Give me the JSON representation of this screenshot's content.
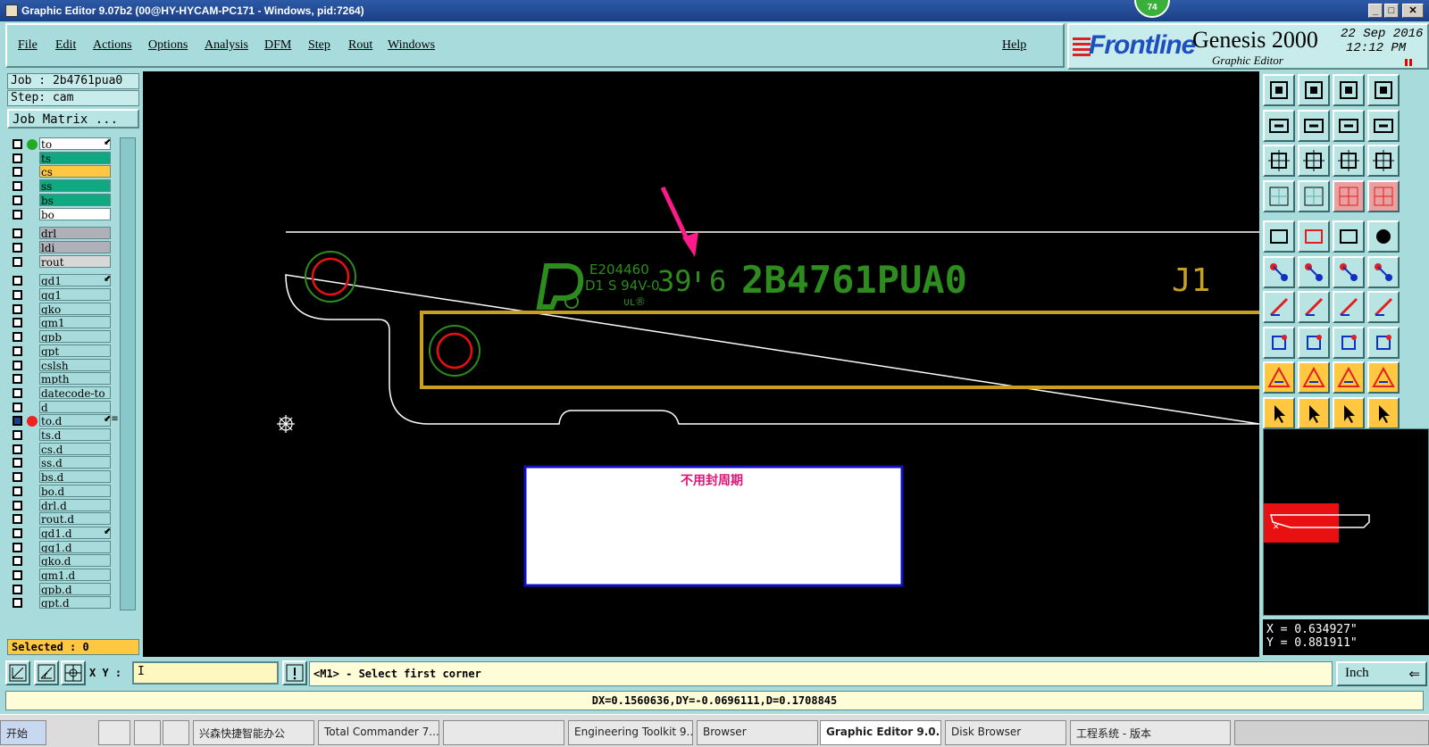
{
  "window": {
    "title": "Graphic Editor 9.07b2 (00@HY-HYCAM-PC171 - Windows, pid:7264)",
    "badge": "74",
    "minimize": "_",
    "maximize": "□",
    "close": "✕"
  },
  "menu": {
    "items": [
      "File",
      "Edit",
      "Actions",
      "Options",
      "Analysis",
      "DFM",
      "Step",
      "Rout",
      "Windows"
    ],
    "help": "Help"
  },
  "brand": {
    "logo": "Frontline",
    "product": "Genesis 2000",
    "subtitle": "Graphic Editor",
    "date": "22  Sep  2016",
    "time": "12:12  PM"
  },
  "job": {
    "job_label": "Job : 2b4761pua0",
    "step_label": "Step: cam",
    "matrix_button": "Job Matrix ..."
  },
  "layers": [
    {
      "name": "to",
      "color": "#ffffff",
      "dot": "#22aa22",
      "mark": "⬋"
    },
    {
      "name": "ts",
      "color": "#10a880"
    },
    {
      "name": "cs",
      "color": "#ffc840"
    },
    {
      "name": "ss",
      "color": "#10a880"
    },
    {
      "name": "bs",
      "color": "#10a880"
    },
    {
      "name": "bo",
      "color": "#ffffff"
    },
    {
      "name": "drl",
      "color": "#b0b0b8",
      "gap": true
    },
    {
      "name": "ldi",
      "color": "#b0b0b8"
    },
    {
      "name": "rout",
      "color": "#d8d8d8"
    },
    {
      "name": "gd1",
      "color": "#a8dcdc",
      "gap": true,
      "mark": "⬋"
    },
    {
      "name": "gg1",
      "color": "#a8dcdc"
    },
    {
      "name": "gko",
      "color": "#a8dcdc"
    },
    {
      "name": "gm1",
      "color": "#a8dcdc"
    },
    {
      "name": "gpb",
      "color": "#a8dcdc"
    },
    {
      "name": "gpt",
      "color": "#a8dcdc"
    },
    {
      "name": "cslsh",
      "color": "#a8dcdc"
    },
    {
      "name": "mpth",
      "color": "#a8dcdc"
    },
    {
      "name": "datecode-to",
      "color": "#a8dcdc"
    },
    {
      "name": "d",
      "color": "#a8dcdc"
    },
    {
      "name": "to.d",
      "color": "#a8dcdc",
      "dot": "#ee2222",
      "selected": true,
      "mark": "⬋≡"
    },
    {
      "name": "ts.d",
      "color": "#a8dcdc"
    },
    {
      "name": "cs.d",
      "color": "#a8dcdc"
    },
    {
      "name": "ss.d",
      "color": "#a8dcdc"
    },
    {
      "name": "bs.d",
      "color": "#a8dcdc"
    },
    {
      "name": "bo.d",
      "color": "#a8dcdc"
    },
    {
      "name": "drl.d",
      "color": "#a8dcdc"
    },
    {
      "name": "rout.d",
      "color": "#a8dcdc"
    },
    {
      "name": "gd1.d",
      "color": "#a8dcdc",
      "mark": "⬋"
    },
    {
      "name": "gg1.d",
      "color": "#a8dcdc"
    },
    {
      "name": "gko.d",
      "color": "#a8dcdc"
    },
    {
      "name": "gm1.d",
      "color": "#a8dcdc"
    },
    {
      "name": "gpb.d",
      "color": "#a8dcdc"
    },
    {
      "name": "gpt.d",
      "color": "#a8dcdc"
    }
  ],
  "selected": "Selected : 0",
  "canvas": {
    "ul_code": "E204460",
    "ul_rating": "D1 S 94V-0",
    "date_code": "39",
    "date_code_2": "6",
    "part_number": "2B4761PUA0",
    "designator": "J1",
    "note": "不用封周期",
    "colors": {
      "silk": "#2e8b1e",
      "pad": "#c8a020",
      "outline": "#ffffff",
      "arrow": "#ff1a8c",
      "note": "#e0157a"
    }
  },
  "coords": {
    "x": "X = 0.634927\"",
    "y": "Y = 0.881911\""
  },
  "bottom": {
    "xy_label": "X Y :",
    "xy_value": "I",
    "prompt": "<M1> - Select first corner",
    "unit": "Inch",
    "unit_icon": "⇐",
    "measure": "DX=0.1560636,DY=-0.0696111,D=0.1708845"
  },
  "taskbar": {
    "items": [
      "开始",
      "",
      "",
      "",
      "兴森快捷智能办公",
      "Total Commander 7...",
      "",
      "Engineering Toolkit 9...",
      "Browser",
      "Graphic Editor 9.0...",
      "Disk Browser",
      "工程系统 - 版本"
    ]
  }
}
